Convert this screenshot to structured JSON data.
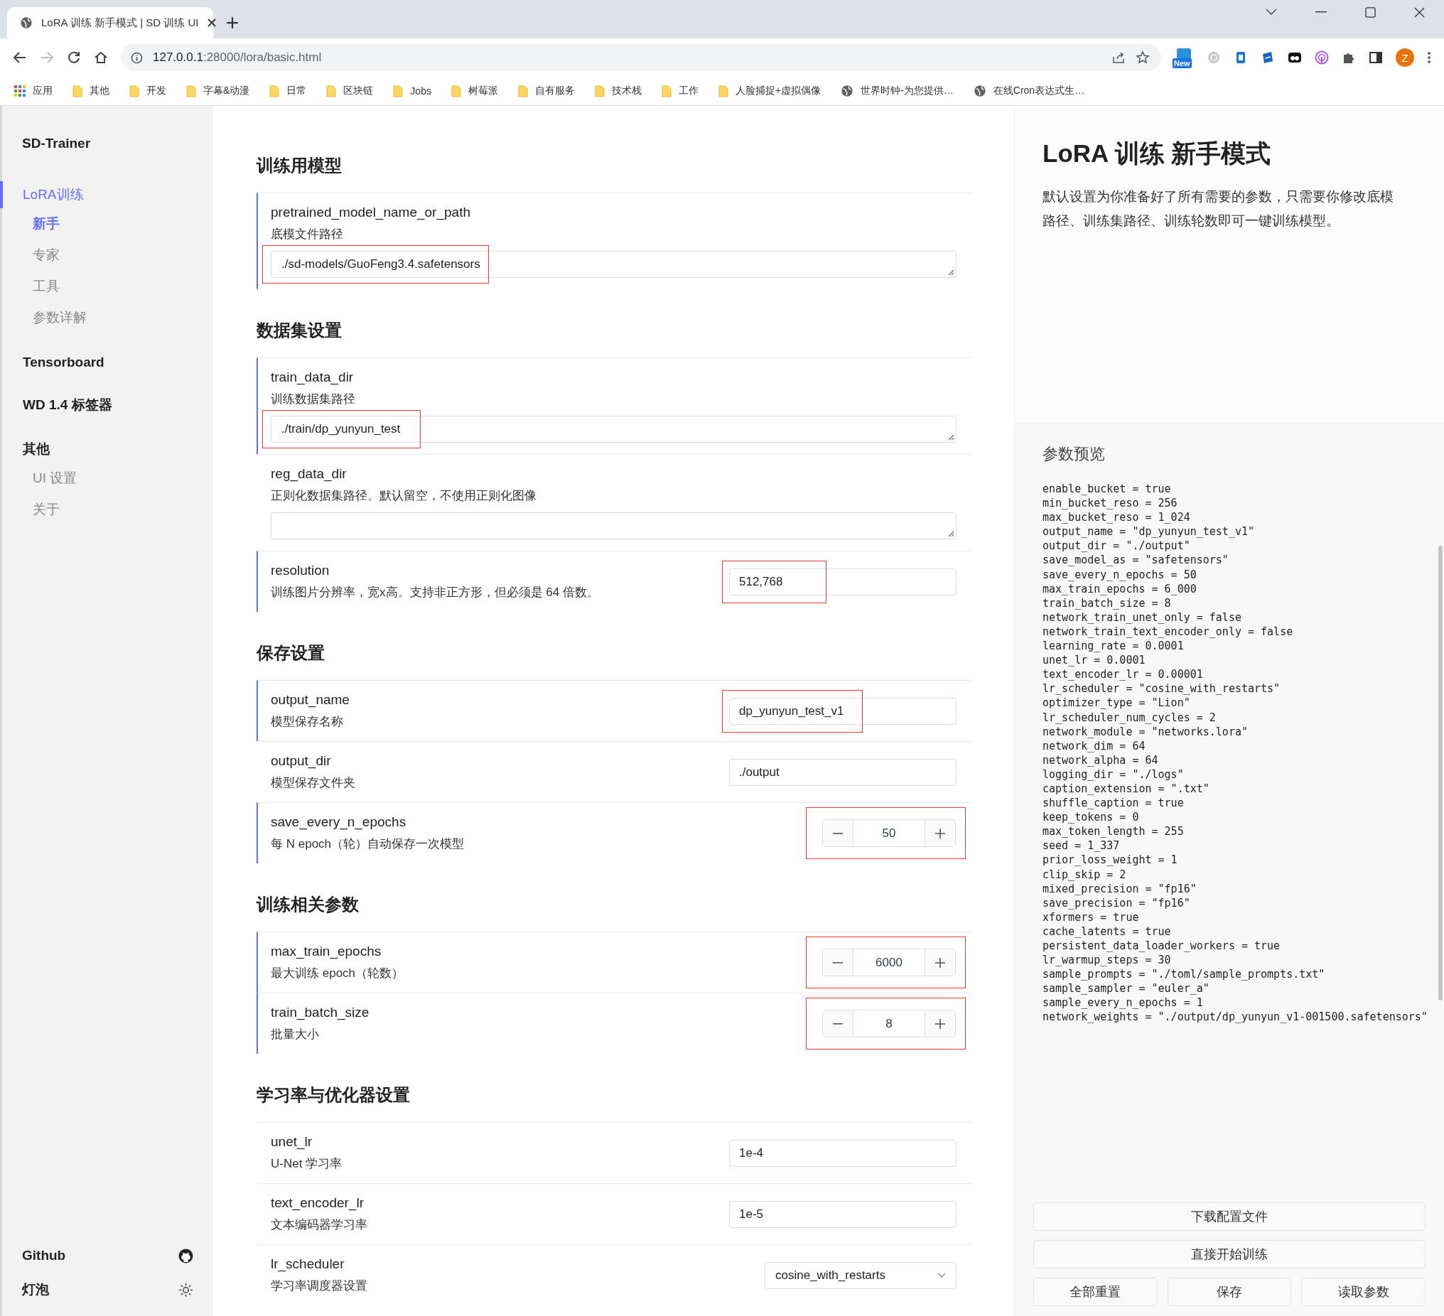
{
  "browser": {
    "tabs": [
      {
        "title": "LoRA 训练 新手模式 | SD 训练 UI",
        "selected": true
      }
    ],
    "nav": [
      {
        "kind": "back",
        "disabled": false
      },
      {
        "kind": "forward",
        "disabled": true
      },
      {
        "kind": "reload",
        "disabled": false
      },
      {
        "kind": "home",
        "disabled": false
      }
    ],
    "url_host": "127.0.0.1",
    "url_path": ":28000/lora/basic.html",
    "extension_badge": "New",
    "profile_initial": "Z",
    "bookmarks": [
      {
        "label": "应用",
        "kind": "apps"
      },
      {
        "label": "其他",
        "kind": "folder"
      },
      {
        "label": "开发",
        "kind": "folder"
      },
      {
        "label": "字幕&动漫",
        "kind": "folder"
      },
      {
        "label": "日常",
        "kind": "folder"
      },
      {
        "label": "区块链",
        "kind": "folder"
      },
      {
        "label": "Jobs",
        "kind": "folder"
      },
      {
        "label": "树莓派",
        "kind": "folder"
      },
      {
        "label": "自有服务",
        "kind": "folder"
      },
      {
        "label": "技术栈",
        "kind": "folder"
      },
      {
        "label": "工作",
        "kind": "folder"
      },
      {
        "label": "人脸捕捉+虚拟偶像",
        "kind": "folder"
      },
      {
        "label": "世界时钟-为您提供…",
        "kind": "site"
      },
      {
        "label": "在线Cron表达式生…",
        "kind": "site"
      }
    ]
  },
  "sidebar": {
    "brand": "SD-Trainer",
    "groups": [
      {
        "label": "LoRA训练",
        "selected": true,
        "children": [
          {
            "label": "新手",
            "selected": true
          },
          {
            "label": "专家",
            "selected": false
          },
          {
            "label": "工具",
            "selected": false
          },
          {
            "label": "参数详解",
            "selected": false
          }
        ]
      },
      {
        "label": "Tensorboard",
        "selected": false
      },
      {
        "label": "WD 1.4 标签器",
        "selected": false
      },
      {
        "label": "其他",
        "selected": false,
        "children": [
          {
            "label": "UI 设置",
            "selected": false
          },
          {
            "label": "关于",
            "selected": false
          }
        ]
      }
    ],
    "footer": [
      {
        "label": "Github",
        "kind": "github"
      },
      {
        "label": "灯泡",
        "kind": "theme"
      }
    ]
  },
  "sections": [
    {
      "title": "训练用模型",
      "rows": [
        {
          "name": "pretrained_model_name_or_path",
          "description": "底模文件路径",
          "kind": "path",
          "value": "./sd-models/GuoFeng3.4.safetensors",
          "modified": true,
          "highlighted": true
        }
      ]
    },
    {
      "title": "数据集设置",
      "rows": [
        {
          "name": "train_data_dir",
          "description": "训练数据集路径",
          "kind": "path",
          "value": "./train/dp_yunyun_test",
          "modified": true,
          "highlighted": true
        },
        {
          "name": "reg_data_dir",
          "description": "正则化数据集路径。默认留空，不使用正则化图像",
          "kind": "path",
          "value": "",
          "modified": false,
          "highlighted": false
        },
        {
          "name": "resolution",
          "description": "训练图片分辨率，宽x高。支持非正方形，但必须是 64 倍数。",
          "kind": "text",
          "value": "512,768",
          "modified": true,
          "highlighted": true
        }
      ]
    },
    {
      "title": "保存设置",
      "rows": [
        {
          "name": "output_name",
          "description": "模型保存名称",
          "kind": "text",
          "value": "dp_yunyun_test_v1",
          "modified": true,
          "highlighted": true
        },
        {
          "name": "output_dir",
          "description": "模型保存文件夹",
          "kind": "text",
          "value": "./output",
          "modified": false,
          "highlighted": false
        },
        {
          "name": "save_every_n_epochs",
          "description": "每 N epoch（轮）自动保存一次模型",
          "kind": "number",
          "value": "50",
          "modified": true,
          "highlighted": true
        }
      ]
    },
    {
      "title": "训练相关参数",
      "rows": [
        {
          "name": "max_train_epochs",
          "description": "最大训练 epoch（轮数）",
          "kind": "number",
          "value": "6000",
          "modified": true,
          "highlighted": true
        },
        {
          "name": "train_batch_size",
          "description": "批量大小",
          "kind": "number",
          "value": "8",
          "modified": true,
          "highlighted": true
        }
      ]
    },
    {
      "title": "学习率与优化器设置",
      "rows": [
        {
          "name": "unet_lr",
          "description": "U-Net 学习率",
          "kind": "text",
          "value": "1e-4",
          "modified": false,
          "highlighted": false
        },
        {
          "name": "text_encoder_lr",
          "description": "文本编码器学习率",
          "kind": "text",
          "value": "1e-5",
          "modified": false,
          "highlighted": false
        },
        {
          "name": "lr_scheduler",
          "description": "学习率调度器设置",
          "kind": "select",
          "value": "cosine_with_restarts",
          "modified": false,
          "highlighted": false
        }
      ]
    }
  ],
  "panel": {
    "title": "LoRA 训练 新手模式",
    "description": "默认设置为你准备好了所有需要的参数，只需要你修改底模路径、训练集路径、训练轮数即可一键训练模型。",
    "preview_title": "参数预览",
    "preview_lines": [
      "enable_bucket = true",
      "min_bucket_reso = 256",
      "max_bucket_reso = 1_024",
      "output_name = \"dp_yunyun_test_v1\"",
      "output_dir = \"./output\"",
      "save_model_as = \"safetensors\"",
      "save_every_n_epochs = 50",
      "max_train_epochs = 6_000",
      "train_batch_size = 8",
      "network_train_unet_only = false",
      "network_train_text_encoder_only = false",
      "learning_rate = 0.0001",
      "unet_lr = 0.0001",
      "text_encoder_lr = 0.00001",
      "lr_scheduler = \"cosine_with_restarts\"",
      "optimizer_type = \"Lion\"",
      "lr_scheduler_num_cycles = 2",
      "network_module = \"networks.lora\"",
      "network_dim = 64",
      "network_alpha = 64",
      "logging_dir = \"./logs\"",
      "caption_extension = \".txt\"",
      "shuffle_caption = true",
      "keep_tokens = 0",
      "max_token_length = 255",
      "seed = 1_337",
      "prior_loss_weight = 1",
      "clip_skip = 2",
      "mixed_precision = \"fp16\"",
      "save_precision = \"fp16\"",
      "xformers = true",
      "cache_latents = true",
      "persistent_data_loader_workers = true",
      "lr_warmup_steps = 30",
      "sample_prompts = \"./toml/sample_prompts.txt\"",
      "sample_sampler = \"euler_a\"",
      "sample_every_n_epochs = 1",
      "network_weights = \"./output/dp_yunyun_v1-001500.safetensors\""
    ],
    "buttons": [
      {
        "label": "下载配置文件",
        "kind": "wide"
      },
      {
        "label": "直接开始训练",
        "kind": "wide"
      },
      {
        "label": "全部重置",
        "kind": "small"
      },
      {
        "label": "保存",
        "kind": "small"
      },
      {
        "label": "读取参数",
        "kind": "small"
      }
    ]
  }
}
